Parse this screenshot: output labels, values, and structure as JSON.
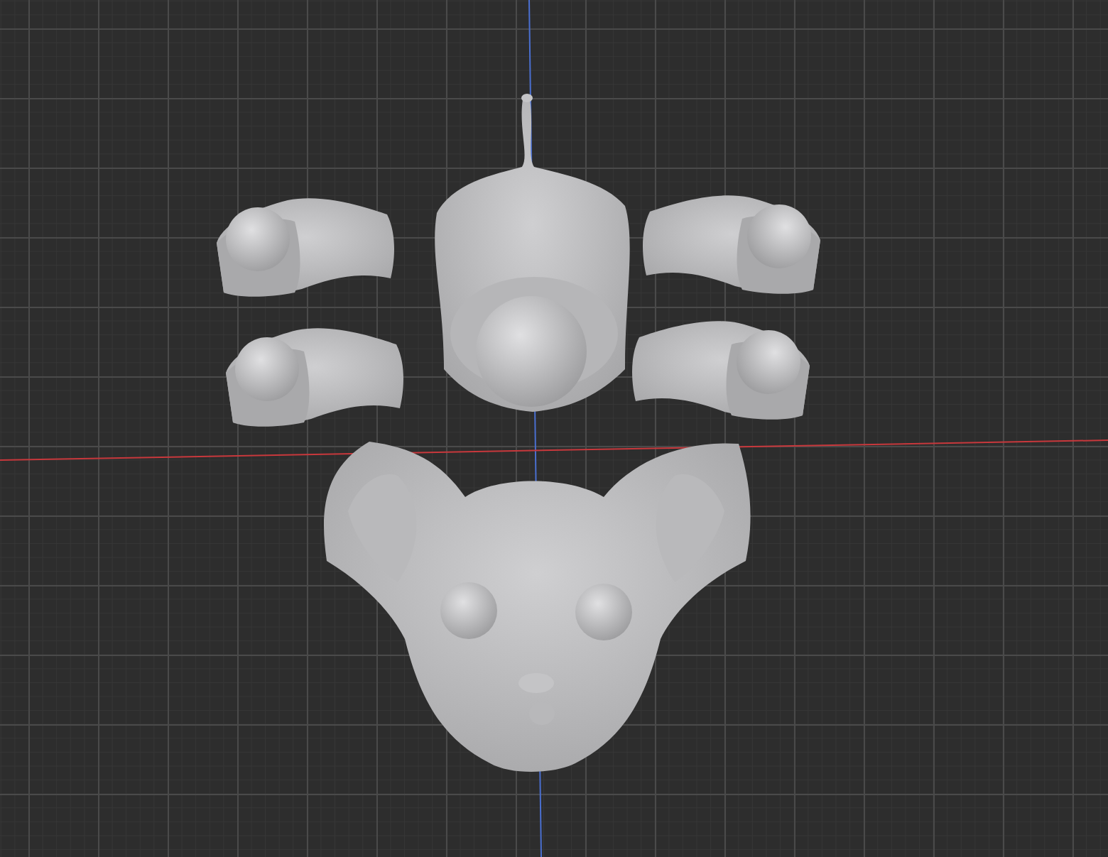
{
  "viewport": {
    "x_axis": true,
    "y_axis": true
  }
}
